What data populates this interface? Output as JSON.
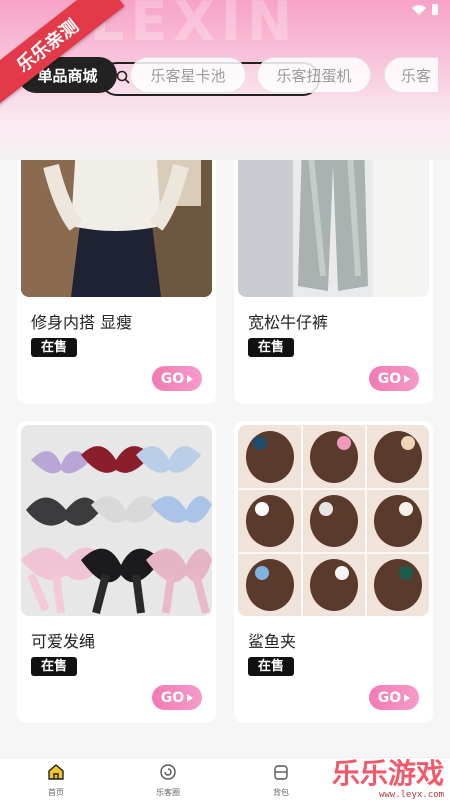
{
  "header": {
    "watermark": "LEXIN",
    "ribbon": "乐乐亲测"
  },
  "tabs": [
    {
      "label": "单品商城",
      "active": true
    },
    {
      "label": "乐客星卡池",
      "active": false
    },
    {
      "label": "乐客扭蛋机",
      "active": false
    },
    {
      "label": "乐客",
      "active": false
    }
  ],
  "products": [
    {
      "name": "修身内搭 显瘦",
      "status": "在售",
      "go_label": "GO",
      "image_icon": "product-photo-slim-top"
    },
    {
      "name": "宽松牛仔裤",
      "status": "在售",
      "go_label": "GO",
      "image_icon": "product-photo-jeans"
    },
    {
      "name": "可爱发绳",
      "status": "在售",
      "go_label": "GO",
      "image_icon": "product-photo-hair-bows"
    },
    {
      "name": "鲨鱼夹",
      "status": "在售",
      "go_label": "GO",
      "image_icon": "product-photo-claw-clips"
    }
  ],
  "bottom_nav": [
    {
      "label": "首页",
      "icon": "home-icon",
      "active": true
    },
    {
      "label": "乐客圈",
      "icon": "circle-icon",
      "active": false
    },
    {
      "label": "背包",
      "icon": "backpack-icon",
      "active": false
    }
  ],
  "site_watermark": {
    "title": "乐乐游戏",
    "url": "www.leyx.com"
  },
  "colors": {
    "accent_pink": "#f27ab2",
    "tab_active_bg": "#222222",
    "badge_bg": "#111111",
    "nav_active": "#f2c230"
  }
}
